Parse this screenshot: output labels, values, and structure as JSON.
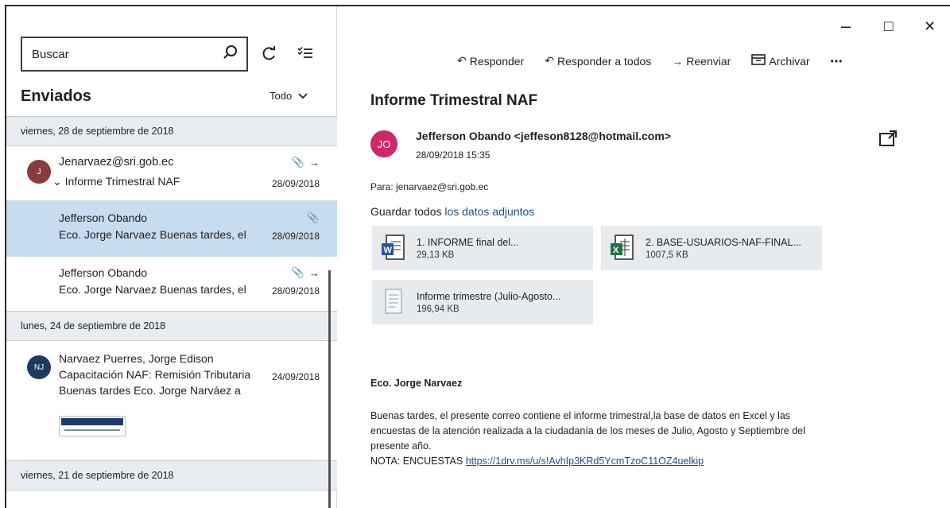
{
  "window": {
    "minimize": "–",
    "maximize": "□",
    "close": "✕"
  },
  "search": {
    "placeholder": "Buscar"
  },
  "folder": {
    "title": "Enviados",
    "filter": "Todo"
  },
  "date_groups": [
    "viernes, 28 de septiembre de 2018",
    "lunes, 24 de septiembre de 2018",
    "viernes, 21 de septiembre de 2018"
  ],
  "messages": [
    {
      "initials": "J",
      "from": "Jenarvaez@sri.gob.ec",
      "subject": "Informe Trimestral NAF",
      "date": "28/09/2018"
    },
    {
      "from": "Jefferson Obando",
      "preview": "Eco. Jorge Narvaez Buenas tardes, el",
      "date": "28/09/2018"
    },
    {
      "from": "Jefferson Obando",
      "preview": "Eco. Jorge Narvaez Buenas tardes, el",
      "date": "28/09/2018"
    },
    {
      "initials": "NJ",
      "from": "Narvaez Puerres, Jorge Edison",
      "subject": "Capacitación NAF: Remisión Tributaria",
      "preview": "Buenas tardes Eco. Jorge Narváez a",
      "date": "24/09/2018"
    }
  ],
  "toolbar": {
    "reply": "Responder",
    "reply_all": "Responder a todos",
    "forward": "Reenviar",
    "archive": "Archivar",
    "more": "•••"
  },
  "email": {
    "subject": "Informe Trimestral NAF",
    "avatar": "JO",
    "sender": "Jefferson Obando <jeffeson8128@hotmail.com>",
    "date": "28/09/2018 15:35",
    "to": "Para: jenarvaez@sri.gob.ec",
    "save_all_prefix": "Guardar todos ",
    "save_all_link": "los datos adjuntos",
    "attachments": [
      {
        "name": "1. INFORME final del...",
        "size": "29,13 KB",
        "icon": "word-icon"
      },
      {
        "name": "2. BASE-USUARIOS-NAF-FINAL...",
        "size": "1007,5 KB",
        "icon": "excel-icon"
      },
      {
        "name": "Informe trimestre (Julio-Agosto...",
        "size": "196,94 KB",
        "icon": "image-file-icon"
      }
    ],
    "greeting": "Eco. Jorge Narvaez",
    "body_lines": [
      "Buenas tardes, el presente correo contiene el informe trimestral,la base de datos en Excel y las",
      "encuestas de la atención realizada a la ciudadanía de los meses de Julio, Agosto y Septiembre del",
      "presente año."
    ],
    "note_label": "NOTA: ENCUESTAS ",
    "note_link": "https://1drv.ms/u/s!AvhIp3KRd5YcmTzoC11OZ4uelkip"
  }
}
